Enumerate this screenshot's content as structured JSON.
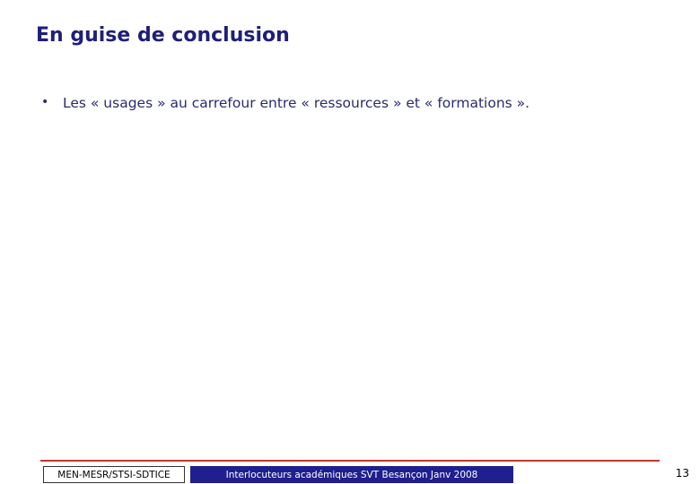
{
  "slide": {
    "title": "En guise de conclusion",
    "bullets": [
      {
        "marker": "•",
        "text": "Les « usages » au carrefour entre « ressources » et « formations »."
      }
    ]
  },
  "footer": {
    "left_label": "MEN-MESR/STSI-SDTICE",
    "center_label": "Interlocuteurs académiques SVT Besançon Janv 2008",
    "page_number": "13",
    "rule_color": "#c0392b",
    "center_box_color": "#1f1f8f"
  }
}
